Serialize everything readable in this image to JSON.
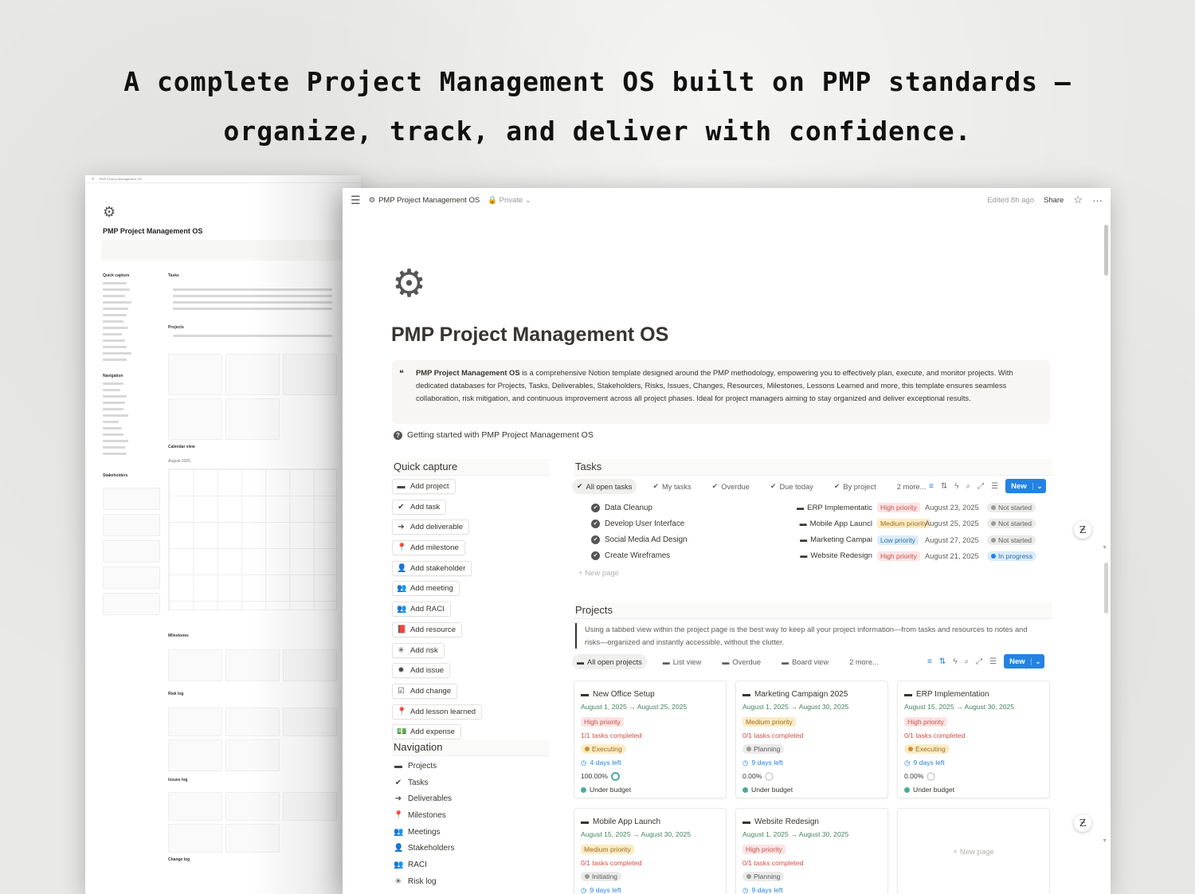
{
  "headline": {
    "line1": "A complete Project Management OS built on PMP standards –",
    "line2": "organize, track, and deliver with confidence."
  },
  "back_window": {
    "breadcrumb": "PMP Project Management OS",
    "title": "PMP Project Management OS",
    "sections": [
      "Quick capture",
      "Navigation",
      "Stakeholders",
      "Tasks",
      "Projects",
      "Calendar view",
      "Milestones",
      "Risk log",
      "Issues log",
      "Change log"
    ],
    "calendar_month": "August 2025"
  },
  "topbar": {
    "breadcrumb": "PMP Project Management OS",
    "privacy": "Private",
    "edited": "Edited 8h ago",
    "share": "Share"
  },
  "page": {
    "title": "PMP Project Management OS",
    "callout_bold": "PMP Project Management OS",
    "callout_text": " is a comprehensive Notion template designed around the PMP methodology, empowering you to effectively plan, execute, and monitor projects. With dedicated databases for Projects, Tasks, Deliverables, Stakeholders, Risks, Issues, Changes, Resources, Milestones, Lessons Learned and more, this template ensures seamless collaboration, risk mitigation, and continuous improvement across all project phases. Ideal for project managers aiming to stay organized and deliver exceptional results.",
    "getting_started": "Getting started with PMP Project Management OS"
  },
  "quick_capture": {
    "title": "Quick capture",
    "buttons": [
      {
        "label": "Add project",
        "icon": "folder-icon"
      },
      {
        "label": "Add task",
        "icon": "check-circle-icon"
      },
      {
        "label": "Add deliverable",
        "icon": "arrow-right-icon"
      },
      {
        "label": "Add milestone",
        "icon": "pin-icon"
      },
      {
        "label": "Add stakeholder",
        "icon": "person-icon"
      },
      {
        "label": "Add meeting",
        "icon": "people-icon"
      },
      {
        "label": "Add RACI",
        "icon": "group-icon"
      },
      {
        "label": "Add resource",
        "icon": "book-icon"
      },
      {
        "label": "Add risk",
        "icon": "asterisk-icon"
      },
      {
        "label": "Add issue",
        "icon": "bug-icon"
      },
      {
        "label": "Add change",
        "icon": "checkbox-icon"
      },
      {
        "label": "Add lesson learned",
        "icon": "pin-icon"
      },
      {
        "label": "Add expense",
        "icon": "money-icon"
      }
    ]
  },
  "navigation": {
    "title": "Navigation",
    "items": [
      {
        "label": "Projects",
        "icon": "folder-icon"
      },
      {
        "label": "Tasks",
        "icon": "check-circle-icon"
      },
      {
        "label": "Deliverables",
        "icon": "arrow-right-icon"
      },
      {
        "label": "Milestones",
        "icon": "pin-icon"
      },
      {
        "label": "Meetings",
        "icon": "people-icon"
      },
      {
        "label": "Stakeholders",
        "icon": "person-icon"
      },
      {
        "label": "RACI",
        "icon": "group-icon"
      },
      {
        "label": "Risk log",
        "icon": "asterisk-icon"
      }
    ]
  },
  "tasks": {
    "title": "Tasks",
    "tabs": [
      "All open tasks",
      "My tasks",
      "Overdue",
      "Due today",
      "By project",
      "2 more..."
    ],
    "new_label": "New",
    "new_page": "New page",
    "rows": [
      {
        "name": "Data Cleanup",
        "project": "ERP Implementatic",
        "priority": "High priority",
        "priority_level": "high",
        "date": "August 23, 2025",
        "status": "Not started",
        "status_kind": "not"
      },
      {
        "name": "Develop User Interface",
        "project": "Mobile App Launcl",
        "priority": "Medium priority",
        "priority_level": "med",
        "date": "August 25, 2025",
        "status": "Not started",
        "status_kind": "not"
      },
      {
        "name": "Social Media Ad Design",
        "project": "Marketing Campai",
        "priority": "Low priority",
        "priority_level": "low",
        "date": "August 27, 2025",
        "status": "Not started",
        "status_kind": "not"
      },
      {
        "name": "Create Wireframes",
        "project": "Website Redesign",
        "priority": "High priority",
        "priority_level": "high",
        "date": "August 21, 2025",
        "status": "In progress",
        "status_kind": "prog"
      }
    ]
  },
  "projects": {
    "title": "Projects",
    "note": "Using a tabbed view within the project page is the best way to keep all your project information—from tasks and resources to notes and risks—organized and instantly accessible, without the clutter.",
    "tabs": [
      "All open projects",
      "List view",
      "Overdue",
      "Board view",
      "2 more..."
    ],
    "new_label": "New",
    "new_page": "New page",
    "cards": [
      {
        "name": "New Office Setup",
        "dates": "August 1, 2025 → August 25, 2025",
        "priority": "High priority",
        "priority_level": "high",
        "tasks": "1/1 tasks completed",
        "status": "Executing",
        "status_kind": "exec",
        "days": "4 days left",
        "progress": "100.00%",
        "progress_value": 1.0,
        "budget": "Under budget"
      },
      {
        "name": "Marketing Campaign 2025",
        "dates": "August 1, 2025 → August 30, 2025",
        "priority": "Medium priority",
        "priority_level": "med",
        "tasks": "0/1 tasks completed",
        "status": "Planning",
        "status_kind": "plan",
        "days": "9 days left",
        "progress": "0.00%",
        "progress_value": 0.0,
        "budget": "Under budget"
      },
      {
        "name": "ERP Implementation",
        "dates": "August 15, 2025 → August 30, 2025",
        "priority": "High priority",
        "priority_level": "high",
        "tasks": "0/1 tasks completed",
        "status": "Executing",
        "status_kind": "exec",
        "days": "9 days left",
        "progress": "0.00%",
        "progress_value": 0.0,
        "budget": "Under budget"
      },
      {
        "name": "Mobile App Launch",
        "dates": "August 15, 2025 → August 30, 2025",
        "priority": "Medium priority",
        "priority_level": "med",
        "tasks": "0/1 tasks completed",
        "status": "Initiating",
        "status_kind": "init",
        "days": "9 days left"
      },
      {
        "name": "Website Redesign",
        "dates": "August 1, 2025 → August 30, 2025",
        "priority": "High priority",
        "priority_level": "high",
        "tasks": "0/1 tasks completed",
        "status": "Planning",
        "status_kind": "plan",
        "days": "9 days left"
      }
    ]
  },
  "colors": {
    "accent": "#2383e2",
    "high": "#c4554d",
    "medium": "#a26d1b",
    "low": "#2d6da3",
    "date_green": "#448361"
  }
}
